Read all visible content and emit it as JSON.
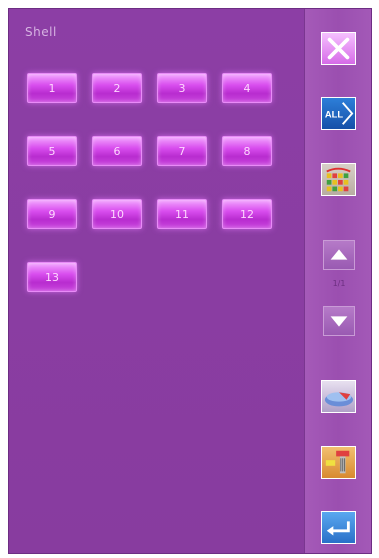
{
  "screen": {
    "title": "Shell"
  },
  "pattern_buttons": [
    "1",
    "2",
    "3",
    "4",
    "5",
    "6",
    "7",
    "8",
    "9",
    "10",
    "11",
    "12",
    "13"
  ],
  "sidebar": {
    "all_label": "ALL",
    "page_indicator": "1/1"
  },
  "colors": {
    "background": "#8a3fa3",
    "button_pink": "#d84dee",
    "sidebar": "#a55ab8"
  },
  "icons": {
    "close": "close-icon",
    "all": "all-arrow-icon",
    "pattern": "pattern-icon",
    "up": "arrow-up-icon",
    "down": "arrow-down-icon",
    "tool": "presser-foot-icon",
    "spool": "bobbin-icon",
    "enter": "enter-icon"
  }
}
